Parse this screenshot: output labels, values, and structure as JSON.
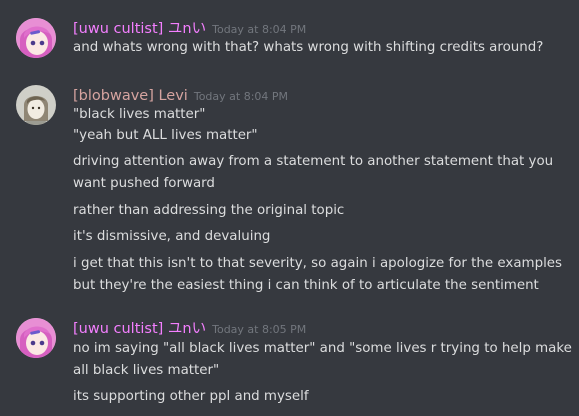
{
  "colors": {
    "background": "#36393f",
    "text": "#dcddde",
    "timestamp": "#72767d",
    "username_uwu": "#f47fff",
    "username_blobwave": "#d6a4a0"
  },
  "messages": [
    {
      "username": "[uwu cultist] ユnい",
      "timestamp": "Today at 8:04 PM",
      "avatar": "pink-anime-avatar",
      "lines": [
        "and whats wrong with that? whats wrong with shifting credits around?"
      ]
    },
    {
      "username": "[blobwave] Levi",
      "timestamp": "Today at 8:04 PM",
      "avatar": "sketch-avatar",
      "lines": [
        "\"black lives matter\"",
        "\"yeah but ALL lives matter\"",
        "driving attention away from a statement to another statement that you",
        "want pushed forward",
        "rather than addressing the original topic",
        "it's dismissive, and devaluing",
        "i get that this isn't to that severity, so again i apologize for the examples",
        "but they're the easiest thing i can think of to articulate the sentiment"
      ]
    },
    {
      "username": "[uwu cultist] ユnい",
      "timestamp": "Today at 8:05 PM",
      "avatar": "pink-anime-avatar",
      "lines": [
        "no im saying \"all black lives matter\" and \"some lives r trying to help make",
        "all black lives matter\"",
        "its supporting other ppl and myself"
      ]
    }
  ]
}
